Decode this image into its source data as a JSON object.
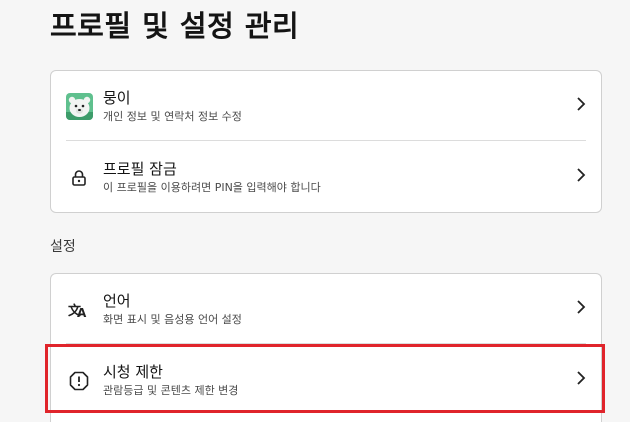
{
  "page": {
    "title": "프로필 및 설정 관리"
  },
  "profile_card": {
    "profile": {
      "name": "뭉이",
      "subtitle": "개인 정보 및 연락처 정보 수정",
      "avatar_icon": "polar-bear-avatar",
      "avatar_bg": "#5fc08e"
    },
    "lock": {
      "label": "프로필 잠금",
      "subtitle": "이 프로필을 이용하려면 PIN을 입력해야 합니다",
      "icon": "lock-icon"
    }
  },
  "settings": {
    "section_title": "설정",
    "items": [
      {
        "label": "언어",
        "subtitle": "화면 표시 및 음성용 언어 설정",
        "icon": "translate-icon"
      },
      {
        "label": "시청 제한",
        "subtitle": "관람등급 및 콘텐츠 제한 변경",
        "icon": "alert-octagon-icon"
      }
    ]
  },
  "colors": {
    "highlight": "#e0242b",
    "background": "#f6f6f6",
    "card": "#ffffff"
  }
}
